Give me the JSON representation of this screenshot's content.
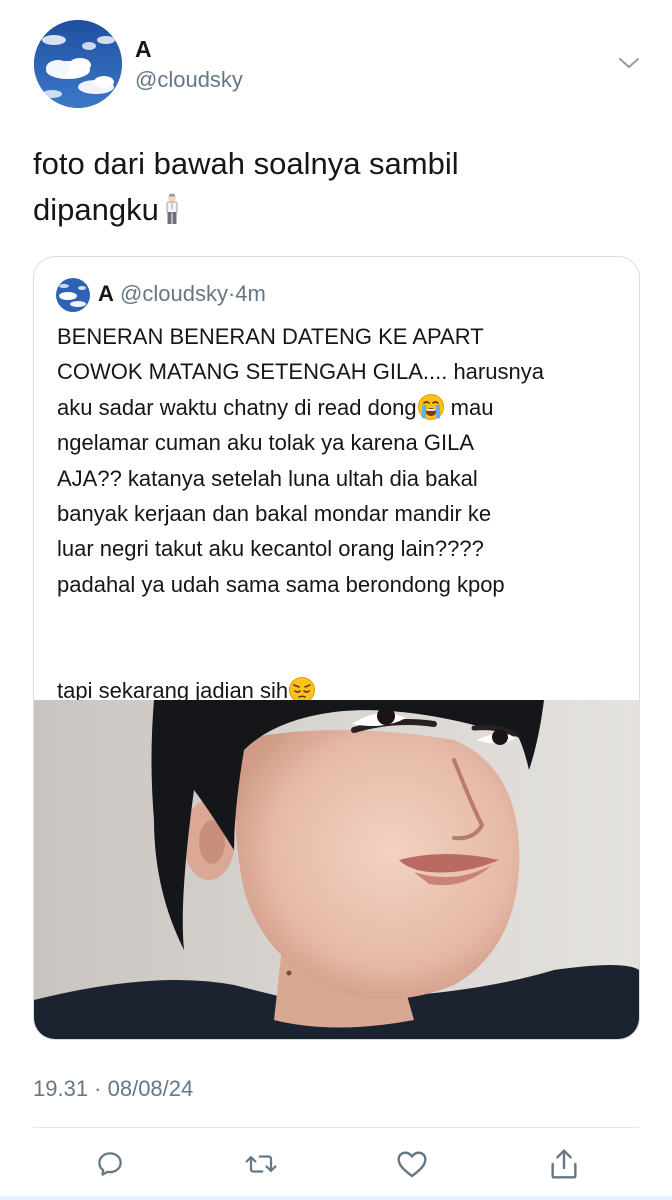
{
  "tweet": {
    "author": {
      "display_name": "A",
      "handle": "@cloudsky"
    },
    "text_lines": [
      "foto dari bawah soalnya sambil",
      "dipangku"
    ],
    "timestamp": "19.31 · 08/08/24"
  },
  "quoted_tweet": {
    "display_name": "A",
    "handle": "@cloudsky",
    "time_ago": "4m",
    "lines": [
      "BENERAN BENERAN DATENG KE APART",
      "COWOK MATANG SETENGAH GILA.... harusnya",
      "aku sadar waktu chatny di read dong",
      " mau",
      "ngelamar cuman aku tolak ya karena GILA",
      "AJA?? katanya setelah luna ultah dia bakal",
      "banyak kerjaan dan bakal mondar mandir ke",
      "luar negri takut aku kecantol orang lain????",
      "padahal ya udah sama sama berondong kpop",
      "tapi sekarang jadian sih"
    ]
  },
  "icons": {
    "menu": "chevron-down-icon",
    "reply": "reply-icon",
    "retweet": "retweet-icon",
    "like": "heart-icon",
    "share": "share-icon",
    "emoji_1": "person-standing-emoji",
    "emoji_2": "loudly-crying-face-emoji",
    "emoji_3": "pensive-face-emoji"
  },
  "colors": {
    "text": "#14171a",
    "secondary": "#657786",
    "border": "#d9dee3",
    "icon": "#657786"
  }
}
